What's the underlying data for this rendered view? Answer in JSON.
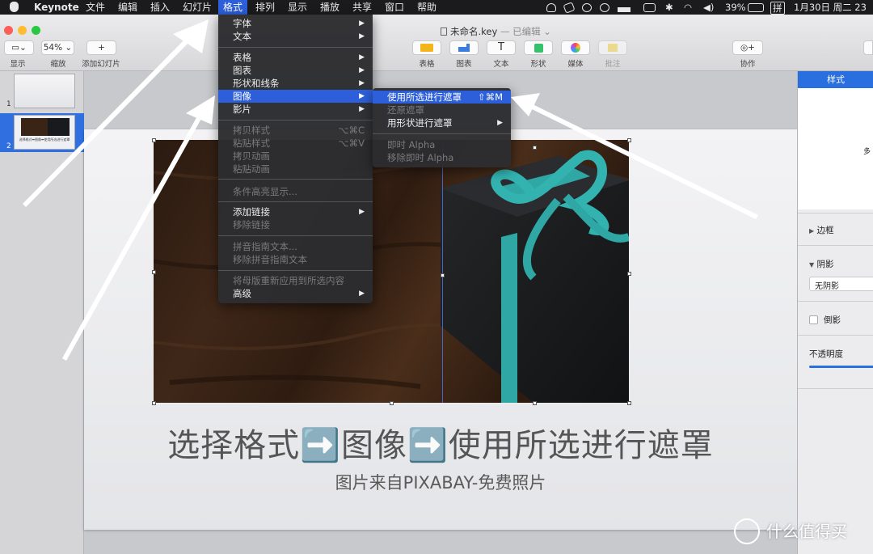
{
  "menubar": {
    "app": "Keynote",
    "items": [
      "文件",
      "编辑",
      "插入",
      "幻灯片",
      "格式",
      "排列",
      "显示",
      "播放",
      "共享",
      "窗口",
      "帮助"
    ],
    "selected": "格式",
    "battery": "39%",
    "ime": "拼",
    "datetime": "1月30日 周二 23"
  },
  "window": {
    "title": "未命名.key",
    "edited": "— 已编辑 ⌄"
  },
  "toolbar": {
    "view_label": "显示",
    "zoom_value": "54%",
    "zoom_label": "缩放",
    "add_slide_label": "添加幻灯片",
    "table": "表格",
    "chart": "图表",
    "text": "文本",
    "shape": "形状",
    "media": "媒体",
    "comment": "批注",
    "collaborate": "协作"
  },
  "slides": [
    {
      "num": "1"
    },
    {
      "num": "2"
    }
  ],
  "thumb_text": "选择格式➡图像➡使用所选进行遮罩",
  "format_menu": {
    "items": [
      {
        "label": "字体",
        "sub": true
      },
      {
        "label": "文本",
        "sub": true
      },
      {
        "sep": true
      },
      {
        "label": "表格",
        "sub": true
      },
      {
        "label": "图表",
        "sub": true
      },
      {
        "label": "形状和线条",
        "sub": true
      },
      {
        "label": "图像",
        "sub": true,
        "selected": true
      },
      {
        "label": "影片",
        "sub": true
      },
      {
        "sep": true
      },
      {
        "label": "拷贝样式",
        "shortcut": "⌥⌘C",
        "disabled": true
      },
      {
        "label": "粘贴样式",
        "shortcut": "⌥⌘V",
        "disabled": true
      },
      {
        "label": "拷贝动画",
        "disabled": true
      },
      {
        "label": "粘贴动画",
        "disabled": true
      },
      {
        "sep": true
      },
      {
        "label": "条件高亮显示...",
        "disabled": true
      },
      {
        "sep": true
      },
      {
        "label": "添加链接",
        "sub": true
      },
      {
        "label": "移除链接",
        "disabled": true
      },
      {
        "sep": true
      },
      {
        "label": "拼音指南文本...",
        "disabled": true
      },
      {
        "label": "移除拼音指南文本",
        "disabled": true
      },
      {
        "sep": true
      },
      {
        "label": "将母版重新应用到所选内容",
        "disabled": true
      },
      {
        "label": "高级",
        "sub": true
      }
    ]
  },
  "image_submenu": {
    "items": [
      {
        "label": "使用所选进行遮罩",
        "shortcut": "⇧⌘M",
        "selected": true
      },
      {
        "label": "还原遮罩",
        "disabled": true
      },
      {
        "label": "用形状进行遮罩",
        "sub": true
      },
      {
        "sep": true
      },
      {
        "label": "即时 Alpha",
        "disabled": true
      },
      {
        "label": "移除即时 Alpha",
        "disabled": true
      }
    ]
  },
  "slide": {
    "title": "选择格式➡️图像➡️使用所选进行遮罩",
    "subtitle": "图片来自PIXABAY-免费照片"
  },
  "inspector": {
    "tab": "样式",
    "partial": "多",
    "border": "边框",
    "shadow": "阴影",
    "shadow_value": "无阴影",
    "reflection": "倒影",
    "opacity": "不透明度"
  },
  "watermark": "什么值得买",
  "colors": {
    "accent": "#2c5fd9",
    "menu_bg": "#2c2c2f",
    "ribbon": "#2fa7a5"
  }
}
